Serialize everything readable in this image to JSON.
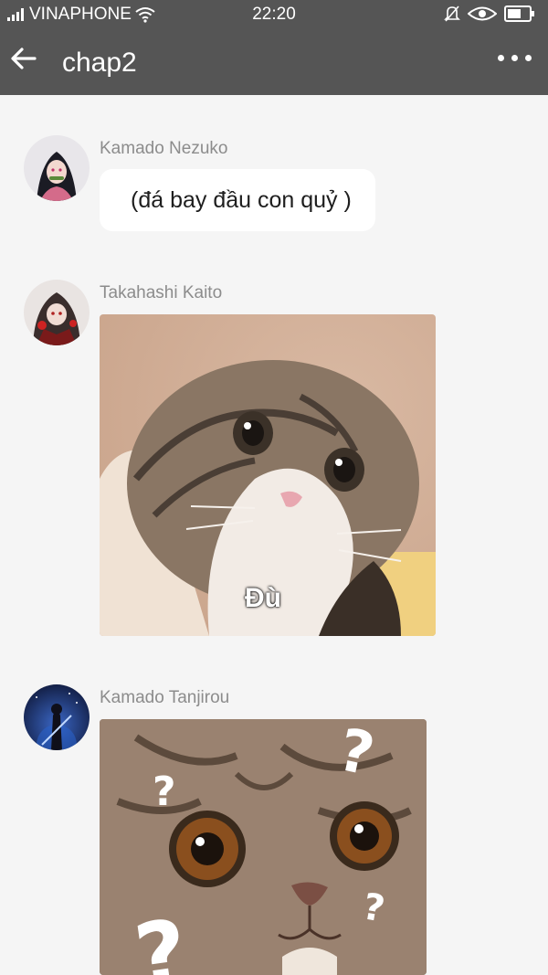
{
  "status_bar": {
    "carrier": "VINAPHONE",
    "time": "22:20",
    "icons": [
      "signal-icon",
      "wifi-icon",
      "mute-icon",
      "eye-icon",
      "battery-icon"
    ]
  },
  "app_bar": {
    "title": "chap2",
    "back_icon": "arrow-left-icon",
    "menu_icon": "more-dots-icon"
  },
  "messages": [
    {
      "sender": "Kamado Nezuko",
      "type": "text",
      "text": "(đá bay đầu con quỷ )"
    },
    {
      "sender": "Takahashi Kaito",
      "type": "image",
      "image_caption": "Đù"
    },
    {
      "sender": "Kamado Tanjirou",
      "type": "image",
      "image_caption": ""
    }
  ],
  "colors": {
    "header_bg": "#555555",
    "page_bg": "#f5f5f5",
    "bubble_bg": "#ffffff",
    "sender_text": "#8c8c8c"
  }
}
